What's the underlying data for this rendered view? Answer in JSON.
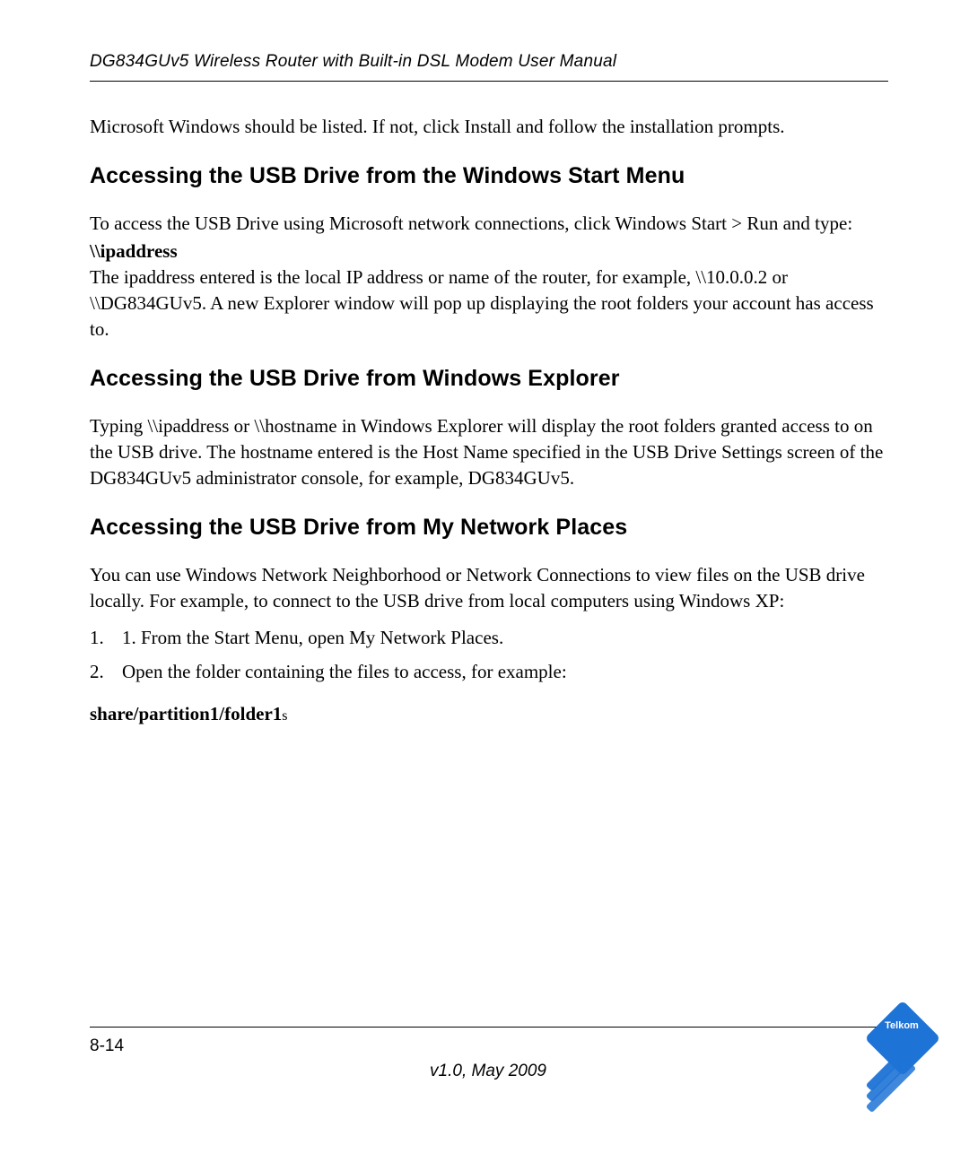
{
  "header": {
    "running_title": "DG834GUv5 Wireless Router with Built-in DSL Modem User Manual"
  },
  "intro_paragraph": "Microsoft Windows should be listed. If not, click Install and follow the installation prompts.",
  "sections": {
    "s1": {
      "heading": "Accessing the USB Drive from the Windows Start Menu",
      "p1": "To access the USB Drive using Microsoft network connections, click Windows Start > Run and type:",
      "code": "\\\\ipaddress",
      "p2": "The ipaddress entered is the local IP address or name of the router, for example, \\\\10.0.0.2 or \\\\DG834GUv5. A new Explorer window will pop up displaying the root folders your account has access to."
    },
    "s2": {
      "heading": "Accessing the USB Drive from Windows Explorer",
      "p1": "Typing \\\\ipaddress or \\\\hostname in Windows Explorer will display the root folders granted access to on the USB drive. The hostname entered is the Host Name specified in the USB Drive Settings screen of the DG834GUv5 administrator console, for example, DG834GUv5."
    },
    "s3": {
      "heading": "Accessing the USB Drive from My Network Places",
      "p1": "You can use Windows Network Neighborhood or Network Connections to view files on the USB drive locally. For example, to connect to the USB drive from local computers using Windows XP:",
      "steps": {
        "n1": "1.",
        "t1": "1. From the Start Menu, open My Network Places.",
        "n2": "2.",
        "t2": "Open the folder containing the files to access, for example:"
      },
      "share_path_bold": "share/partition1/folder1",
      "share_path_suffix": "s"
    }
  },
  "footer": {
    "page_number": "8-14",
    "version": "v1.0, May 2009"
  },
  "logo": {
    "name": "Telkom"
  }
}
